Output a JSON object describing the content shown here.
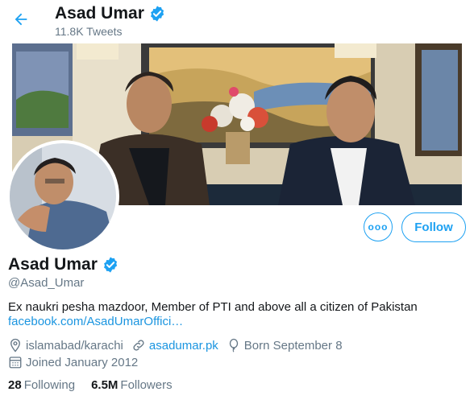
{
  "header": {
    "name": "Asad Umar",
    "tweet_count": "11.8K Tweets"
  },
  "actions": {
    "more_label": "ooo",
    "follow_label": "Follow"
  },
  "profile": {
    "name": "Asad Umar",
    "handle": "@Asad_Umar",
    "bio": "Ex naukri pesha mazdoor, Member of PTI  and above all a citizen of Pakistan",
    "bio_link": "facebook.com/AsadUmarOffici…",
    "location": "islamabad/karachi",
    "website": "asadumar.pk",
    "birthday": "Born September 8",
    "joined": "Joined January 2012"
  },
  "stats": {
    "following_count": "28",
    "following_label": "Following",
    "followers_count": "6.5M",
    "followers_label": "Followers"
  },
  "colors": {
    "accent": "#1da1f2",
    "link": "#1b95e0",
    "muted": "#657786",
    "text": "#14171a"
  },
  "icons": {
    "back": "arrow-left-icon",
    "verified": "verified-badge-icon",
    "location": "location-pin-icon",
    "website": "link-icon",
    "birthday": "balloon-icon",
    "joined": "calendar-icon"
  }
}
